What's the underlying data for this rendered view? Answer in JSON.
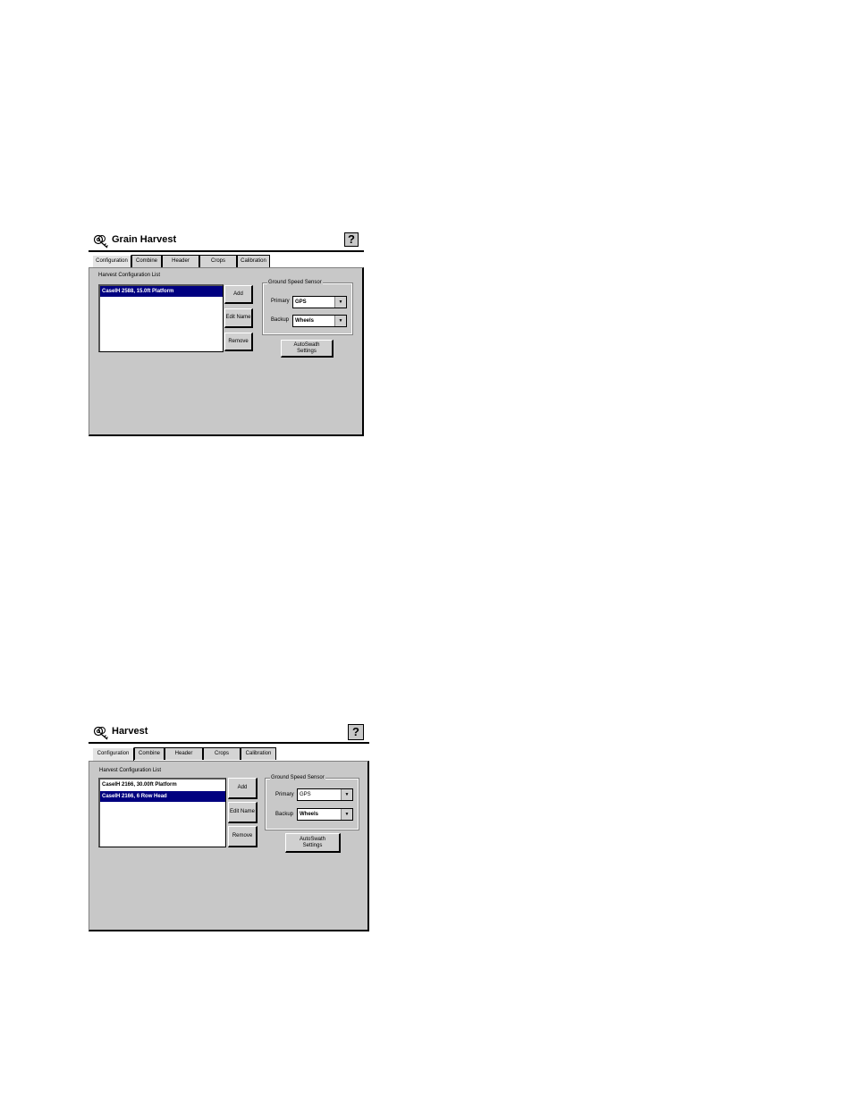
{
  "screens": [
    {
      "title": "Grain Harvest",
      "help_label": "?",
      "tabs": [
        "Configuration",
        "Combine",
        "Header",
        "Crops",
        "Calibration"
      ],
      "list_label": "Harvest Configuration List",
      "list_items": [
        {
          "text": "CaseIH 2588, 15.0ft Platform",
          "selected": true
        }
      ],
      "buttons": {
        "add": "Add",
        "edit": "Edit Name",
        "remove": "Remove",
        "autoswath": "AutoSwath Settings"
      },
      "sensor_group": "Ground Speed Sensor",
      "primary_label": "Primary",
      "primary_value": "GPS",
      "backup_label": "Backup",
      "backup_value": "Wheels"
    },
    {
      "title": "Harvest",
      "help_label": "?",
      "tabs": [
        "Configuration",
        "Combine",
        "Header",
        "Crops",
        "Calibration"
      ],
      "list_label": "Harvest Configuration List",
      "list_items": [
        {
          "text": "CaseIH 2166, 30.00ft Platform",
          "selected": false
        },
        {
          "text": "CaseIH 2166, 6 Row Head",
          "selected": true
        }
      ],
      "buttons": {
        "add": "Add",
        "edit": "Edit Name",
        "remove": "Remove",
        "autoswath": "AutoSwath Settings"
      },
      "sensor_group": "Ground Speed Sensor",
      "primary_label": "Primary",
      "primary_value": "GPS",
      "backup_label": "Backup",
      "backup_value": "Wheels"
    }
  ],
  "colors": {
    "selection": "#000080",
    "panel": "#c8c8c8"
  },
  "icons": [
    "keys-icon",
    "help-icon",
    "dropdown-arrow-icon"
  ]
}
